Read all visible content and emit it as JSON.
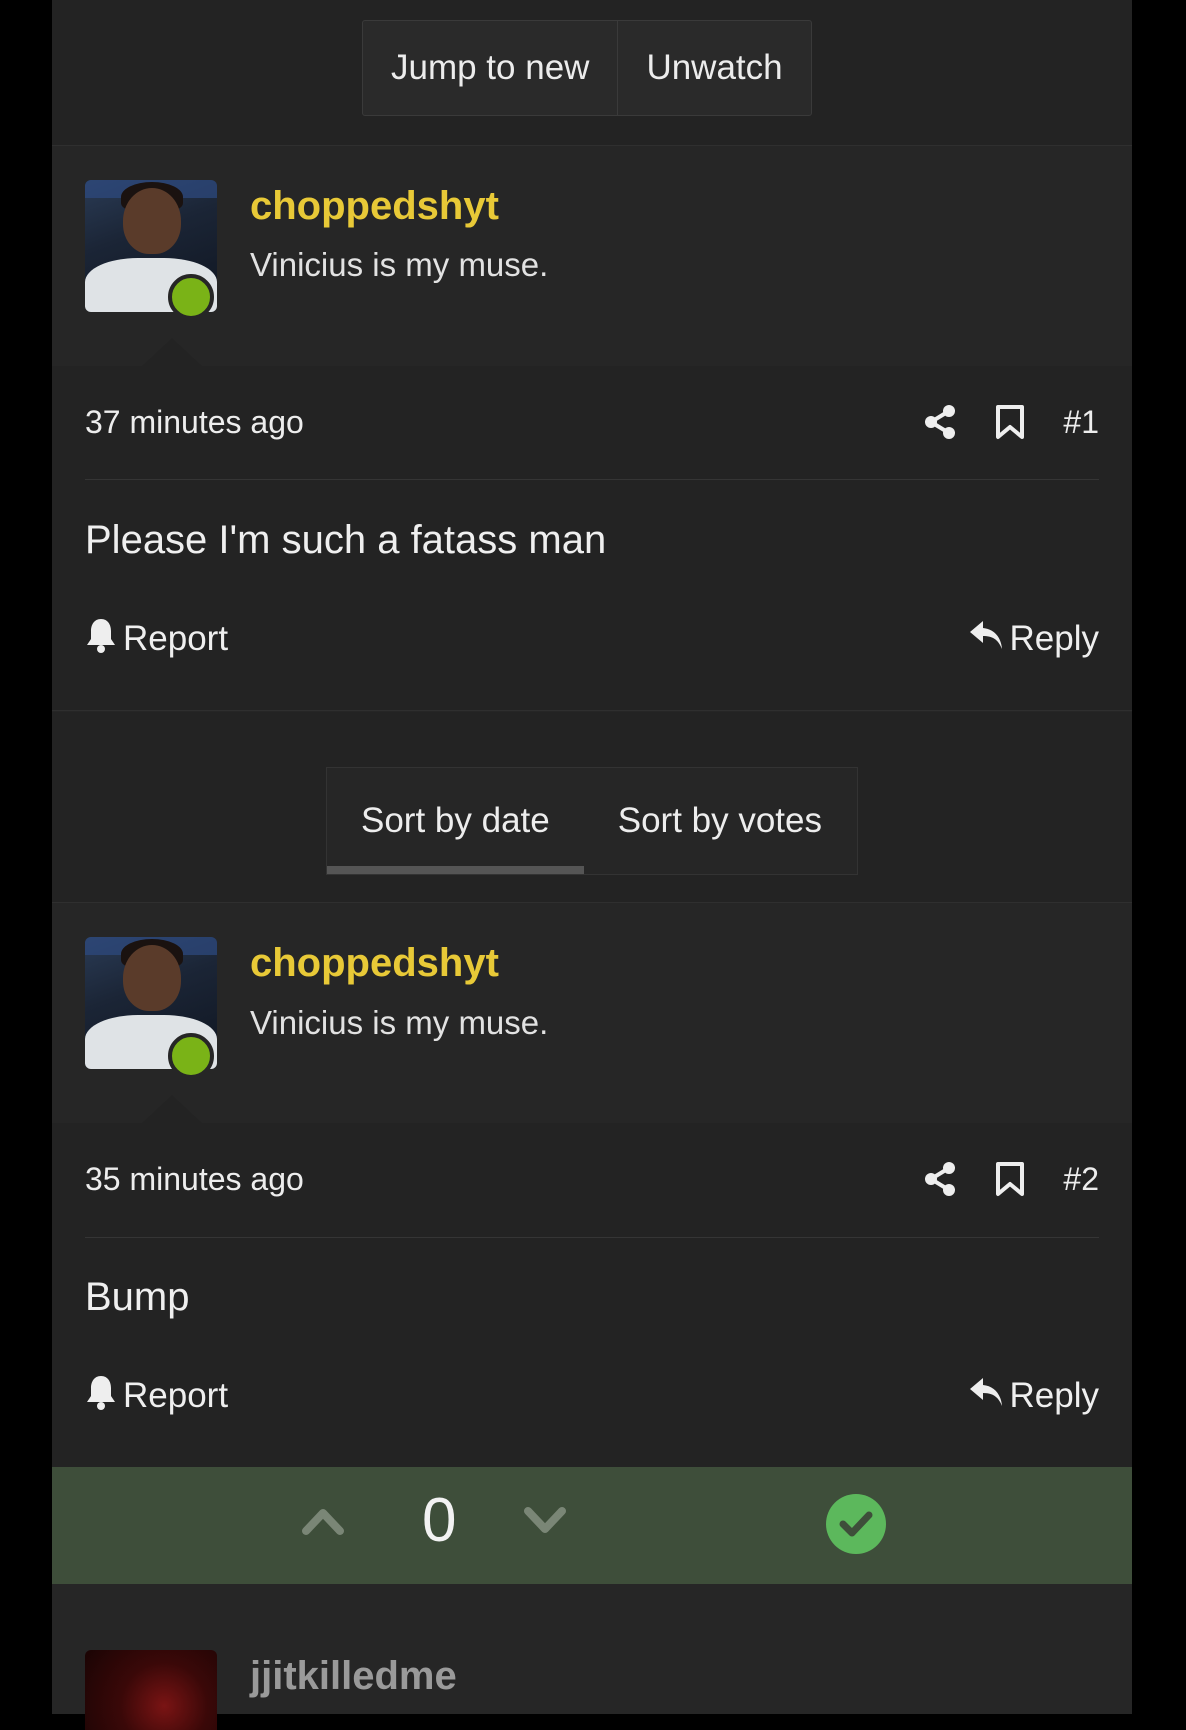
{
  "top_actions": {
    "jump_to_new": "Jump to new",
    "unwatch": "Unwatch"
  },
  "posts": [
    {
      "username": "choppedshyt",
      "user_title": "Vinicius is my muse.",
      "time": "37 minutes ago",
      "post_number": "#1",
      "message": "Please I'm such a fatass man",
      "report_label": "Report",
      "reply_label": "Reply"
    },
    {
      "username": "choppedshyt",
      "user_title": "Vinicius is my muse.",
      "time": "35 minutes ago",
      "post_number": "#2",
      "message": "Bump",
      "report_label": "Report",
      "reply_label": "Reply"
    }
  ],
  "sort": {
    "by_date": "Sort by date",
    "by_votes": "Sort by votes",
    "active": "by_date"
  },
  "votes": {
    "count": "0"
  },
  "next_post": {
    "username": "jjitkilledme"
  },
  "colors": {
    "username": "#e8c937",
    "online": "#7ab317",
    "vote_bar": "#3e4e3a",
    "solution": "#5cb85c"
  }
}
